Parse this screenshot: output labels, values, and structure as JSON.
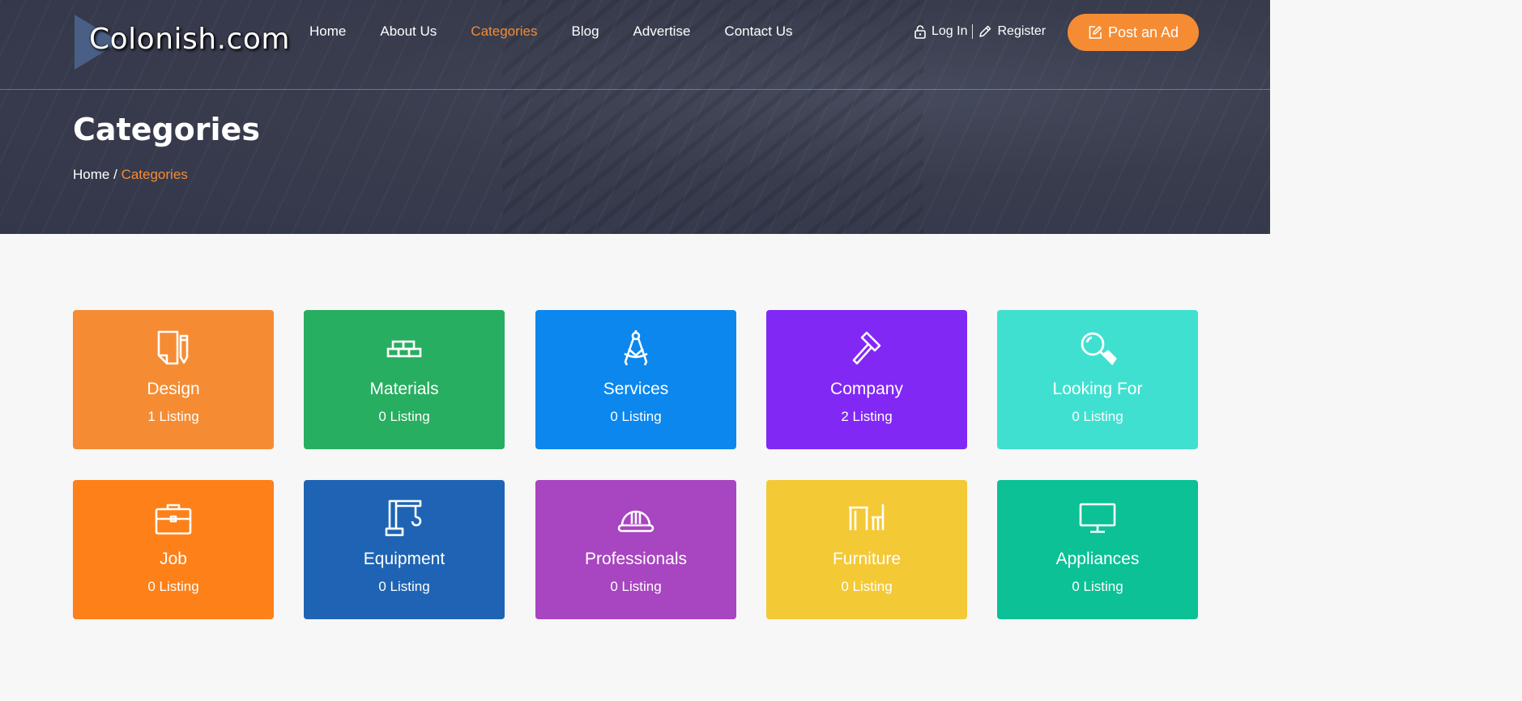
{
  "header": {
    "logo_text": "Colonish.com",
    "nav": [
      {
        "label": "Home",
        "active": false
      },
      {
        "label": "About Us",
        "active": false
      },
      {
        "label": "Categories",
        "active": true
      },
      {
        "label": "Blog",
        "active": false
      },
      {
        "label": "Advertise",
        "active": false
      },
      {
        "label": "Contact Us",
        "active": false
      }
    ],
    "login_label": "Log In",
    "register_label": "Register",
    "post_ad_label": "Post an Ad"
  },
  "hero": {
    "title": "Categories",
    "breadcrumb": {
      "home": "Home",
      "separator": "/",
      "current": "Categories"
    }
  },
  "colors": {
    "accent": "#f58c34",
    "hero_bg": "#383c4d",
    "page_bg": "#f7f7f7"
  },
  "categories": [
    {
      "name": "Design",
      "count": "1 Listing",
      "color": "#f58c34",
      "icon": "design-paper-pencil-icon"
    },
    {
      "name": "Materials",
      "count": "0 Listing",
      "color": "#27ae60",
      "icon": "bricks-icon"
    },
    {
      "name": "Services",
      "count": "0 Listing",
      "color": "#0b87ee",
      "icon": "compass-icon"
    },
    {
      "name": "Company",
      "count": "2 Listing",
      "color": "#8128f5",
      "icon": "hammer-icon"
    },
    {
      "name": "Looking For",
      "count": "0 Listing",
      "color": "#40e0d0",
      "icon": "magnifier-icon"
    },
    {
      "name": "Job",
      "count": "0 Listing",
      "color": "#fd8019",
      "icon": "briefcase-icon"
    },
    {
      "name": "Equipment",
      "count": "0 Listing",
      "color": "#1f64b4",
      "icon": "crane-icon"
    },
    {
      "name": "Professionals",
      "count": "0 Listing",
      "color": "#a845c0",
      "icon": "hard-hat-icon"
    },
    {
      "name": "Furniture",
      "count": "0 Listing",
      "color": "#f4c936",
      "icon": "table-chair-icon"
    },
    {
      "name": "Appliances",
      "count": "0 Listing",
      "color": "#0bc195",
      "icon": "monitor-icon"
    }
  ]
}
